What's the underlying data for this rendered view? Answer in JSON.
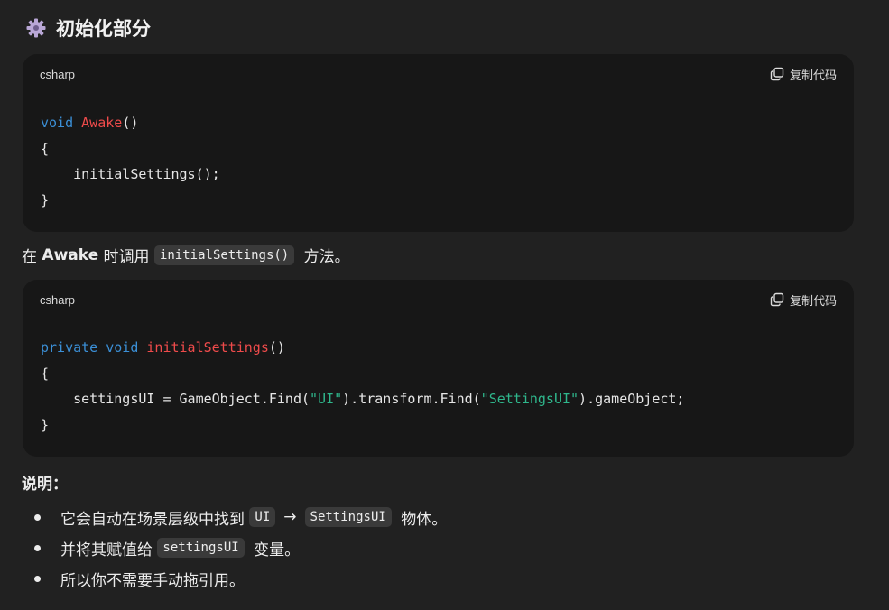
{
  "heading": {
    "icon": "gear-icon",
    "title": "初始化部分"
  },
  "code_blocks": [
    {
      "language": "csharp",
      "copy_label": "复制代码",
      "lines": {
        "l1_kw": "void",
        "l1_fn": "Awake",
        "l1_rest": "()",
        "l2": "{",
        "l3": "    initialSettings();",
        "l4": "}"
      }
    },
    {
      "language": "csharp",
      "copy_label": "复制代码",
      "lines": {
        "l1_kw1": "private",
        "l1_kw2": "void",
        "l1_fn": "initialSettings",
        "l1_rest": "()",
        "l2": "{",
        "l3_a": "    settingsUI = GameObject.Find(",
        "l3_s1": "\"UI\"",
        "l3_b": ").transform.Find(",
        "l3_s2": "\"SettingsUI\"",
        "l3_c": ").gameObject;",
        "l4": "}"
      }
    }
  ],
  "paragraph1": {
    "prefix": "在 ",
    "bold": "Awake",
    "middle": " 时调用 ",
    "code": "initialSettings()",
    "suffix": " 方法。"
  },
  "notes": {
    "title": "说明：",
    "items": [
      {
        "before": "它会自动在场景层级中找到 ",
        "code1": "UI",
        "arrow": "→",
        "code2": "SettingsUI",
        "after": " 物体。"
      },
      {
        "before": "并将其赋值给 ",
        "code1": "settingsUI",
        "after": " 变量。"
      },
      {
        "text": "所以你不需要手动拖引用。"
      }
    ]
  }
}
